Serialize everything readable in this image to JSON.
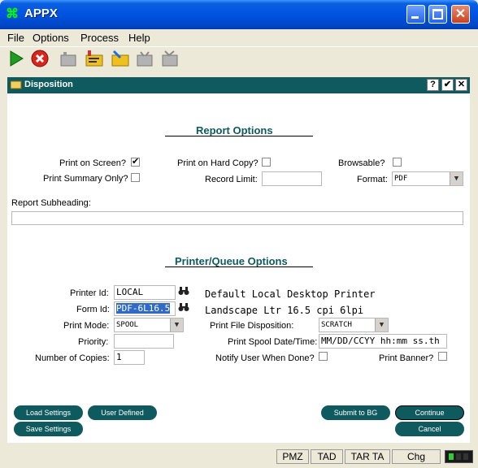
{
  "window": {
    "title": "APPX"
  },
  "menu": [
    "File",
    "Options",
    "Process",
    "Help"
  ],
  "toolbar": {
    "icons": [
      "play-icon",
      "stop-icon",
      "folder-icon",
      "edit-icon",
      "open-icon",
      "folder-icon",
      "tv-icon"
    ]
  },
  "dialog": {
    "title": "Disposition",
    "help": "?",
    "ok": "✔",
    "close": "✕"
  },
  "report": {
    "section_title": "Report Options",
    "print_on_screen_label": "Print on Screen?",
    "print_on_screen_value": "✔",
    "print_on_hard_copy_label": "Print on Hard Copy?",
    "browsable_label": "Browsable?",
    "print_summary_label": "Print Summary Only?",
    "record_limit_label": "Record Limit:",
    "record_limit_value": "",
    "format_label": "Format:",
    "format_value": "PDF",
    "subheading_label": "Report Subheading:",
    "subheading_value": ""
  },
  "printer": {
    "section_title": "Printer/Queue Options",
    "printer_id_label": "Printer Id:",
    "printer_id_value": "LOCAL",
    "printer_desc": "Default Local Desktop Printer",
    "form_id_label": "Form Id:",
    "form_id_value": "PDF-6L16.5",
    "form_desc": "Landscape Ltr 16.5 cpi 6lpi",
    "print_mode_label": "Print Mode:",
    "print_mode_value": "SPOOL",
    "file_disposition_label": "Print File Disposition:",
    "file_disposition_value": "SCRATCH",
    "priority_label": "Priority:",
    "priority_value": "",
    "spool_date_label": "Print Spool Date/Time:",
    "spool_date_value": "MM/DD/CCYY hh:mm ss.th",
    "copies_label": "Number of Copies:",
    "copies_value": "1",
    "notify_label": "Notify User When Done?",
    "banner_label": "Print Banner?"
  },
  "buttons": {
    "load": "Load Settings",
    "user_defined": "User Defined",
    "save": "Save Settings",
    "submit": "Submit to BG",
    "continue": "Continue",
    "cancel": "Cancel"
  },
  "status": [
    "PMZ",
    "TAD",
    "TAR TA",
    "Chg"
  ]
}
